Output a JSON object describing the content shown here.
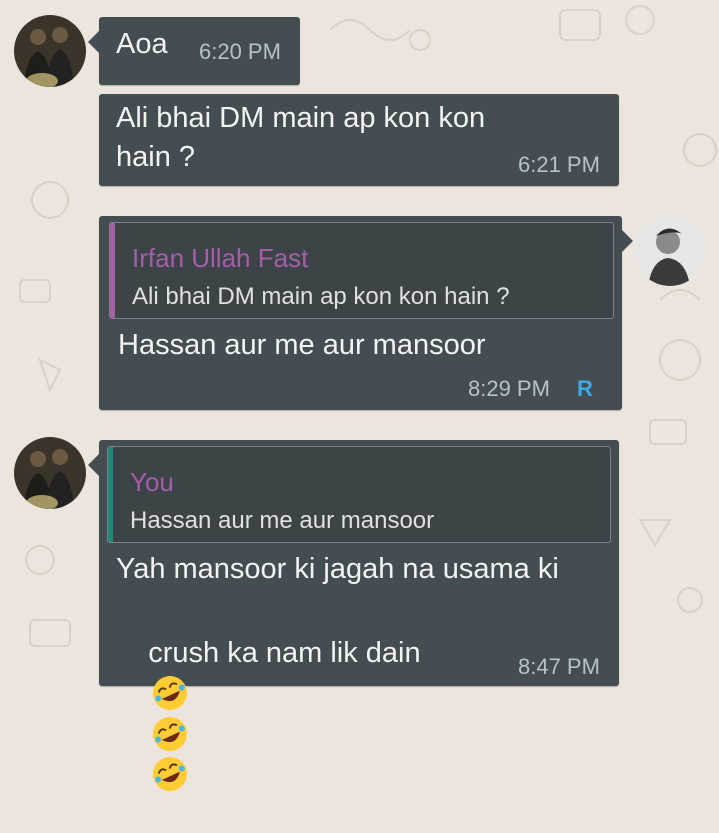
{
  "colors": {
    "background": "#ece5dd",
    "bubble": "#444d52",
    "quote_name": "#a45fa8",
    "quote_bar_other": "#a45fa8",
    "quote_bar_you": "#1f8a7a",
    "time": "#b5c2c8",
    "read_badge": "#3fa8e8"
  },
  "messages": [
    {
      "text": "Aoa",
      "time": "6:20 PM"
    },
    {
      "text": "Ali bhai DM main ap kon kon\nhain ?",
      "time": "6:21 PM"
    },
    {
      "quoted_name": "Irfan Ullah Fast",
      "quoted_text": "Ali bhai DM main ap kon kon hain ?",
      "text": "Hassan aur me aur mansoor",
      "time": "8:29 PM",
      "badge": "R"
    },
    {
      "quoted_name": "You",
      "quoted_text": "Hassan aur me aur mansoor",
      "line1": "Yah mansoor ki jagah na usama ki",
      "line2": "crush ka nam lik dain",
      "emoji": "rolling-on-floor-laughing",
      "time": "8:47 PM"
    }
  ]
}
